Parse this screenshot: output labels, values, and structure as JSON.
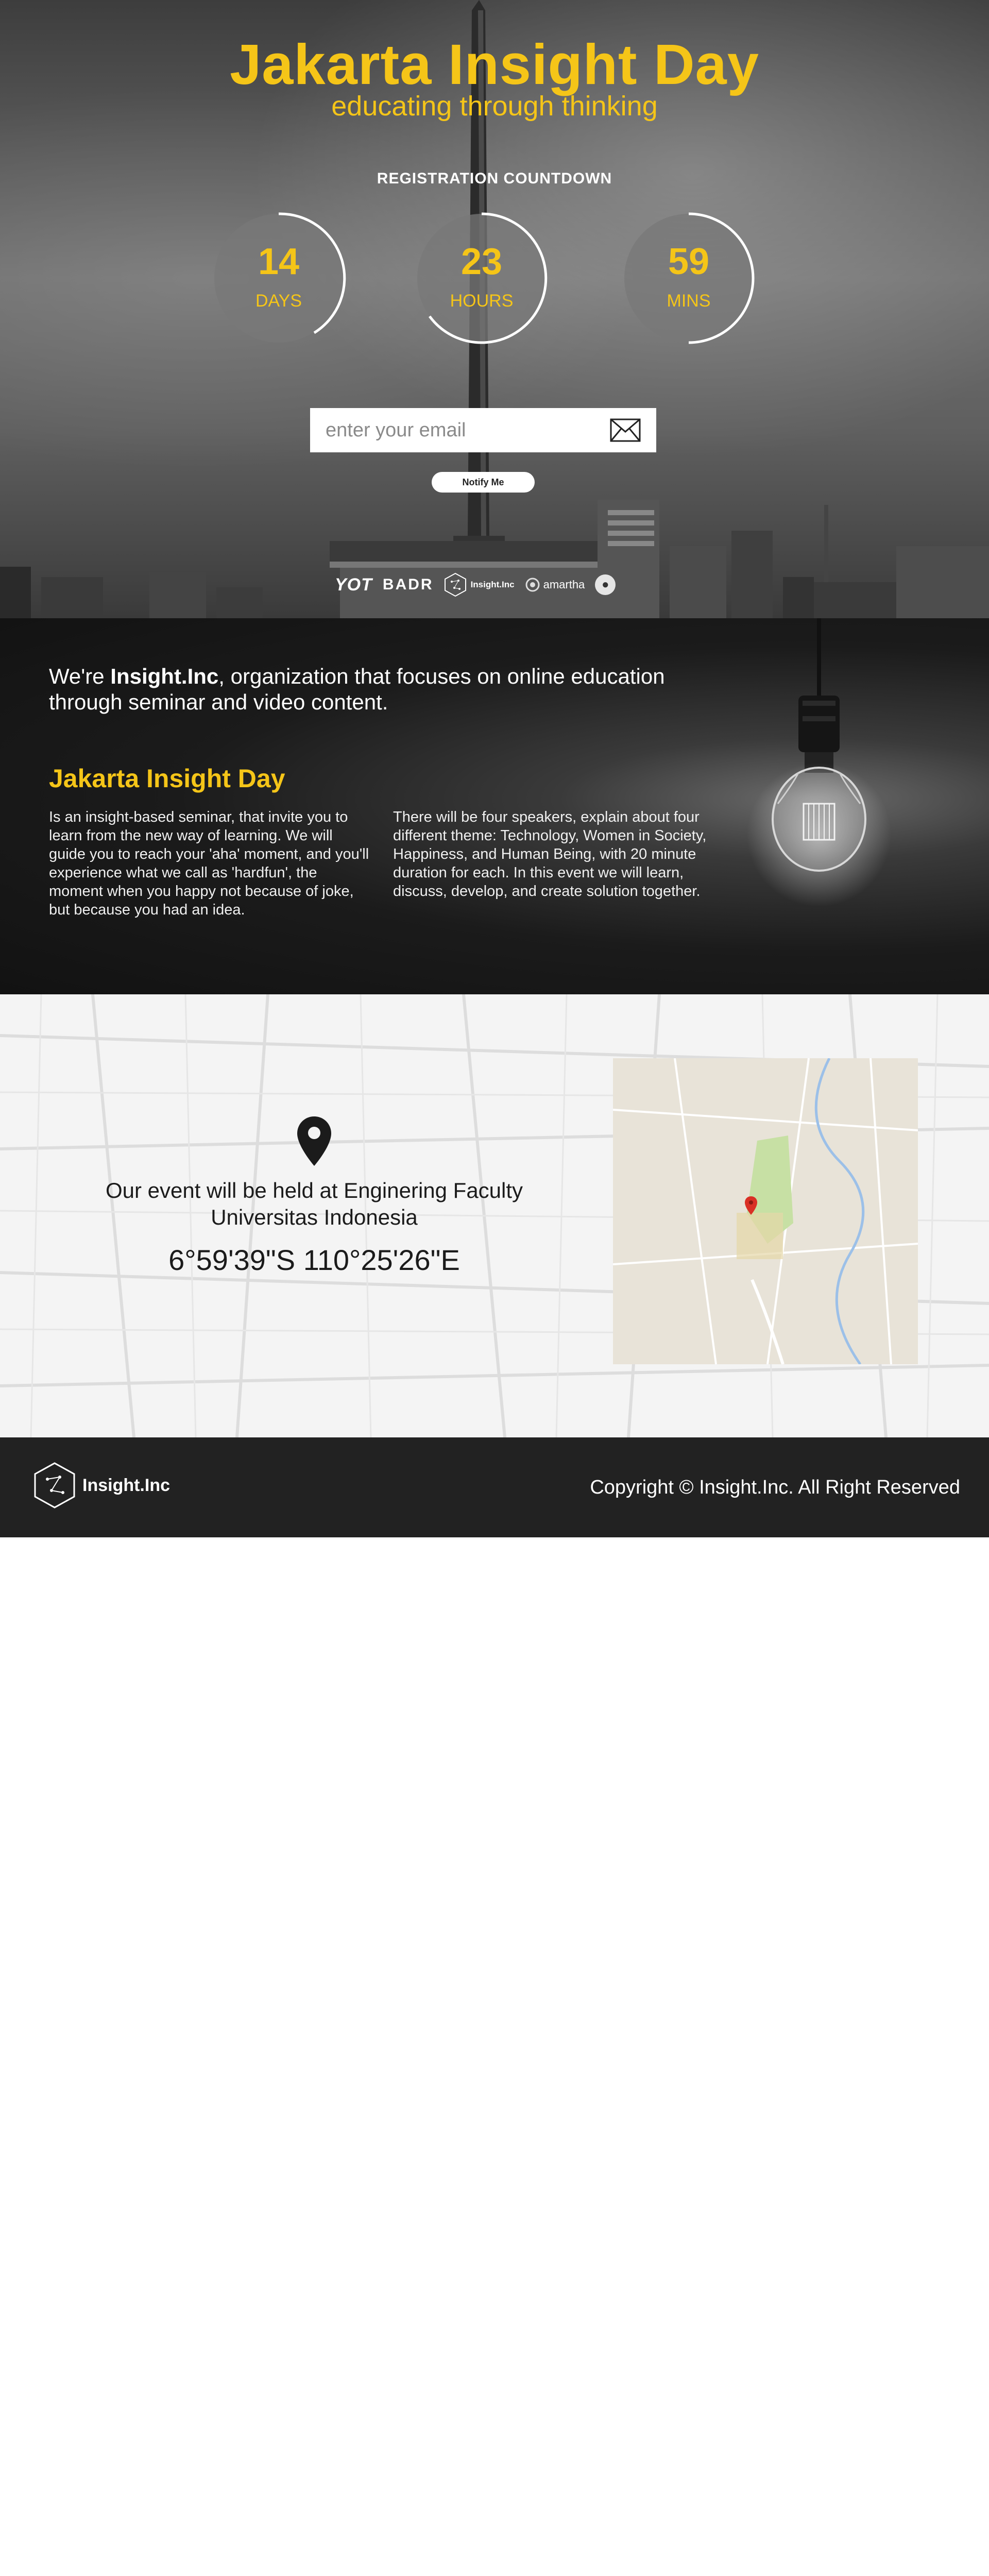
{
  "hero": {
    "title": "Jakarta Insight Day",
    "subtitle": "educating through thinking",
    "countdown_heading": "REGISTRATION COUNTDOWN",
    "timers": [
      {
        "value": "14",
        "unit": "DAYS"
      },
      {
        "value": "23",
        "unit": "HOURS"
      },
      {
        "value": "59",
        "unit": "MINS"
      }
    ],
    "email_placeholder": "enter your email",
    "notify_label": "Notify Me",
    "sponsors": {
      "yot": "YOT",
      "badr": "BADR",
      "insight": "Insight.Inc",
      "amart": "amartha"
    }
  },
  "about": {
    "intro_prefix": "We're ",
    "intro_brand": "Insight.Inc",
    "intro_suffix": ", organization that focuses on online education through seminar and video content.",
    "heading": "Jakarta Insight Day",
    "col_left": "Is an insight-based seminar, that invite you to learn from the new way of learning. We will guide you to reach your 'aha' moment, and you'll experience what we call as 'hardfun', the moment when you happy not because of joke, but because you had an idea.",
    "col_right": "There will be four speakers, explain about four different theme: Technology, Women in Society, Happiness, and Human Being, with 20 minute duration for each. In this event we will learn, discuss, develop, and create solution together."
  },
  "location": {
    "event_text": "Our event will be held at Enginering Faculty Universitas Indonesia",
    "coordinates": "6°59'39\"S 110°25'26\"E"
  },
  "footer": {
    "logo_text": "Insight.Inc",
    "copyright": "Copyright © Insight.Inc. All Right Reserved"
  },
  "colors": {
    "accent": "#f5c518",
    "dark": "#222222"
  }
}
